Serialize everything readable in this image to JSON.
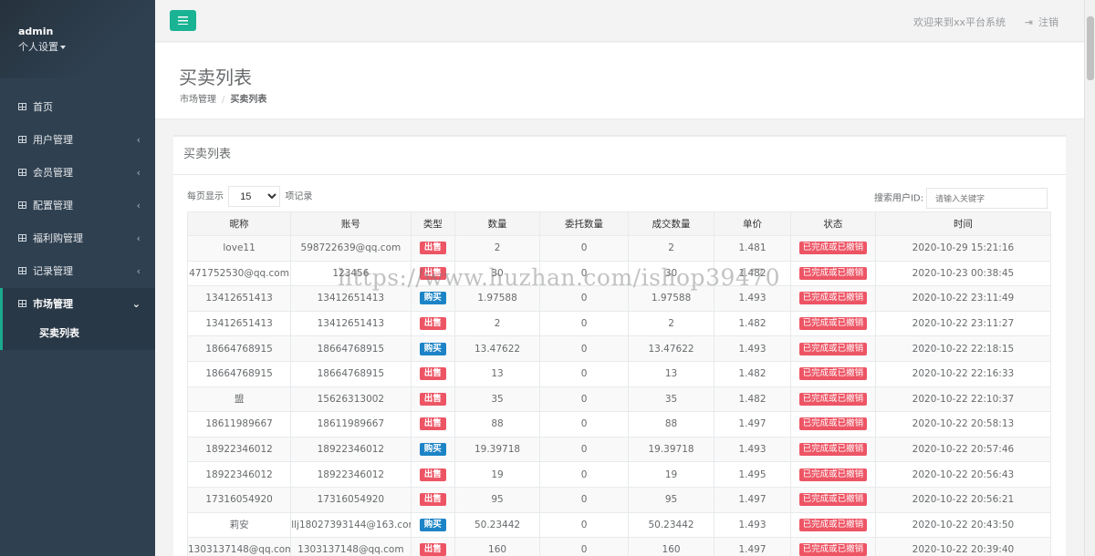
{
  "sidebar": {
    "user": "admin",
    "settings_label": "个人设置",
    "items": [
      {
        "label": "首页"
      },
      {
        "label": "用户管理"
      },
      {
        "label": "会员管理"
      },
      {
        "label": "配置管理"
      },
      {
        "label": "福利购管理"
      },
      {
        "label": "记录管理"
      },
      {
        "label": "市场管理"
      }
    ],
    "sub_item": "买卖列表"
  },
  "topbar": {
    "welcome": "欢迎来到xx平台系统",
    "logout": "注销"
  },
  "heading": {
    "title": "买卖列表",
    "breadcrumb_parent": "市场管理",
    "breadcrumb_current": "买卖列表"
  },
  "panel": {
    "title": "买卖列表",
    "per_page_prefix": "每页显示",
    "per_page_value": "15",
    "per_page_suffix": "项记录",
    "search_label": "搜索用户ID:",
    "search_placeholder": "请输入关键字"
  },
  "table": {
    "headers": [
      "昵称",
      "账号",
      "类型",
      "数量",
      "委托数量",
      "成交数量",
      "单价",
      "状态",
      "时间"
    ],
    "rows": [
      [
        "love11",
        "598722639@qq.com",
        "出售",
        "2",
        "0",
        "2",
        "1.481",
        "已完成或已撤销",
        "2020-10-29 15:21:16"
      ],
      [
        "471752530@qq.com",
        "123456",
        "出售",
        "30",
        "0",
        "30",
        "1.482",
        "已完成或已撤销",
        "2020-10-23 00:38:45"
      ],
      [
        "13412651413",
        "13412651413",
        "购买",
        "1.97588",
        "0",
        "1.97588",
        "1.493",
        "已完成或已撤销",
        "2020-10-22 23:11:49"
      ],
      [
        "13412651413",
        "13412651413",
        "出售",
        "2",
        "0",
        "2",
        "1.482",
        "已完成或已撤销",
        "2020-10-22 23:11:27"
      ],
      [
        "18664768915",
        "18664768915",
        "购买",
        "13.47622",
        "0",
        "13.47622",
        "1.493",
        "已完成或已撤销",
        "2020-10-22 22:18:15"
      ],
      [
        "18664768915",
        "18664768915",
        "出售",
        "13",
        "0",
        "13",
        "1.482",
        "已完成或已撤销",
        "2020-10-22 22:16:33"
      ],
      [
        "盟",
        "15626313002",
        "出售",
        "35",
        "0",
        "35",
        "1.482",
        "已完成或已撤销",
        "2020-10-22 22:10:37"
      ],
      [
        "18611989667",
        "18611989667",
        "出售",
        "88",
        "0",
        "88",
        "1.497",
        "已完成或已撤销",
        "2020-10-22 20:58:13"
      ],
      [
        "18922346012",
        "18922346012",
        "购买",
        "19.39718",
        "0",
        "19.39718",
        "1.493",
        "已完成或已撤销",
        "2020-10-22 20:57:46"
      ],
      [
        "18922346012",
        "18922346012",
        "出售",
        "19",
        "0",
        "19",
        "1.495",
        "已完成或已撤销",
        "2020-10-22 20:56:43"
      ],
      [
        "17316054920",
        "17316054920",
        "出售",
        "95",
        "0",
        "95",
        "1.497",
        "已完成或已撤销",
        "2020-10-22 20:56:21"
      ],
      [
        "莉安",
        "llj18027393144@163.com",
        "购买",
        "50.23442",
        "0",
        "50.23442",
        "1.493",
        "已完成或已撤销",
        "2020-10-22 20:43:50"
      ],
      [
        "1303137148@qq.com",
        "1303137148@qq.com",
        "出售",
        "160",
        "0",
        "160",
        "1.497",
        "已完成或已撤销",
        "2020-10-22 20:39:40"
      ]
    ]
  },
  "watermark": "https://www.huzhan.com/ishop39470",
  "colors": {
    "sidebar": "#2f4050",
    "accent": "#1ab394",
    "sell": "#ed5565",
    "buy": "#1c84c6"
  }
}
